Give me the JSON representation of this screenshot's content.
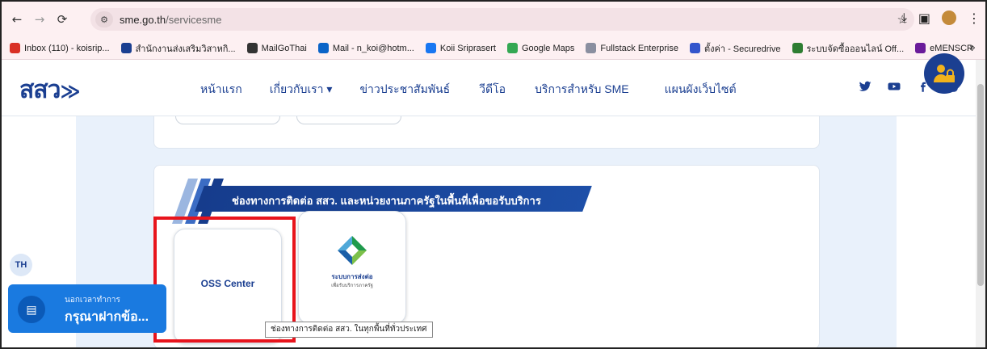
{
  "browser": {
    "back_icon": "arrow-left-icon",
    "forward_icon": "arrow-right-icon",
    "reload_icon": "reload-icon",
    "url_domain": "sme.go.th",
    "url_path": "/servicesme"
  },
  "bookmarks": [
    {
      "label": "Inbox (110) - koisrip...",
      "color": "#d93025"
    },
    {
      "label": "สำนักงานส่งเสริมวิสาหกิ...",
      "color": "#1b3f91"
    },
    {
      "label": "MailGoThai",
      "color": "#333333"
    },
    {
      "label": "Mail - n_koi@hotm...",
      "color": "#0a64c8"
    },
    {
      "label": "Koii Sriprasert",
      "color": "#1877f2"
    },
    {
      "label": "Google Maps",
      "color": "#34a853"
    },
    {
      "label": "Fullstack Enterprise",
      "color": "#8a8fa0"
    },
    {
      "label": "ตั้งค่า - Securedrive",
      "color": "#3355cc"
    },
    {
      "label": "ระบบจัดซื้อออนไลน์ Off...",
      "color": "#2e7d32"
    },
    {
      "label": "eMENSCR",
      "color": "#6a1b9a"
    }
  ],
  "site": {
    "logo": "สสว",
    "menu": [
      "หน้าแรก",
      "เกี่ยวกับเรา ▾",
      "ข่าวประชาสัมพันธ์",
      "วีดีโอ",
      "บริการสำหรับ SME",
      "แผนผังเว็บไซต์"
    ],
    "social": [
      "twitter-icon",
      "youtube-icon",
      "facebook-icon",
      "instagram-icon"
    ]
  },
  "section": {
    "banner_title": "ช่องทางการติดต่อ สสว. และหน่วยงานภาครัฐในพื้นที่เพื่อขอรับบริการ",
    "oss_label": "OSS Center",
    "gov_line1": "ระบบการส่งต่อ",
    "gov_line2": "เพื่อรับบริการภาครัฐ",
    "tooltip": "ช่องทางการติดต่อ สสว. ในทุกพื้นที่ทั่วประเทศ"
  },
  "widgets": {
    "lang": "TH",
    "chat_small": "นอกเวลาทำการ",
    "chat_big": "กรุณาฝากข้อ..."
  }
}
